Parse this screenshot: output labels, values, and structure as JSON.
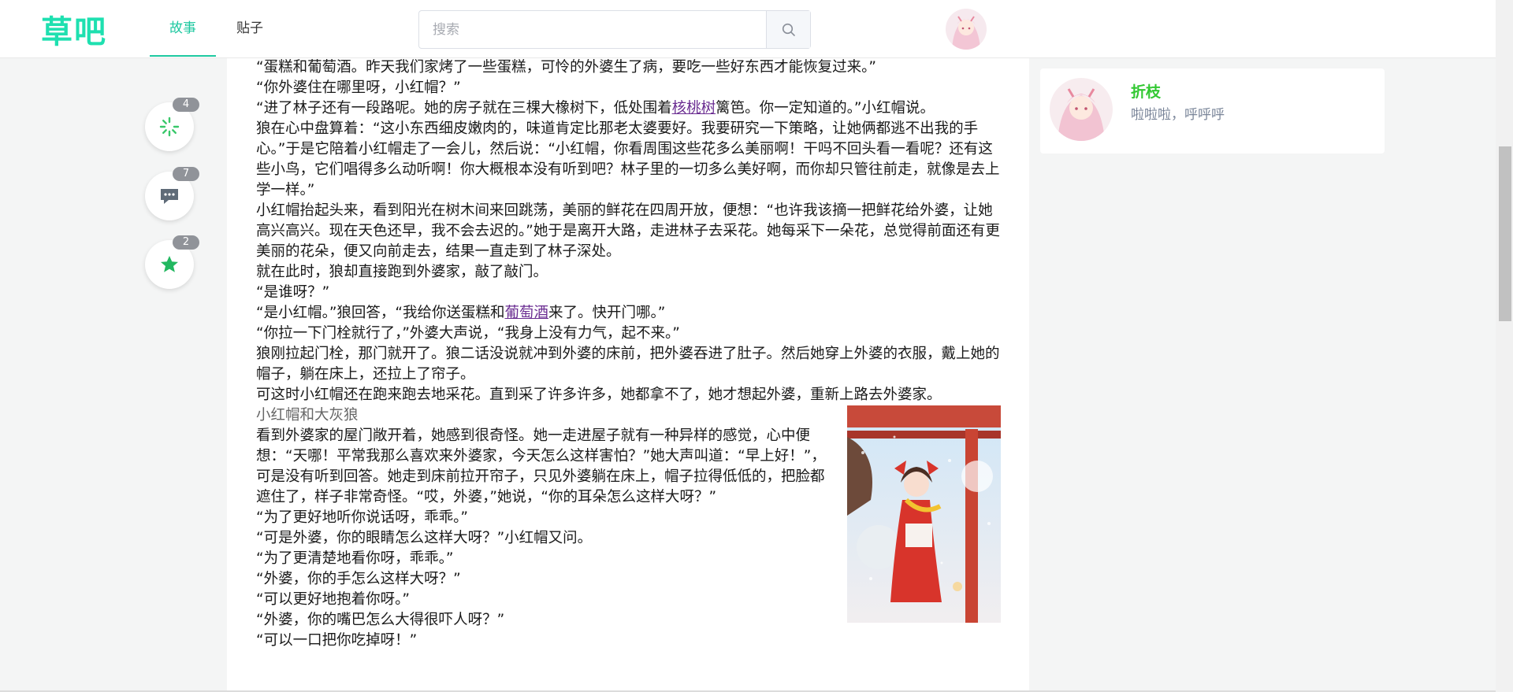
{
  "header": {
    "logo": "草吧",
    "tabs": [
      {
        "label": "故事",
        "active": true
      },
      {
        "label": "贴子",
        "active": false
      }
    ],
    "search": {
      "placeholder": "搜索",
      "value": ""
    }
  },
  "actions": [
    {
      "icon": "loading-icon",
      "count": "4"
    },
    {
      "icon": "comment-icon",
      "count": "7"
    },
    {
      "icon": "star-icon",
      "count": "2"
    }
  ],
  "article": {
    "p1": "“蛋糕和葡萄酒。昨天我们家烤了一些蛋糕，可怜的外婆生了病，要吃一些好东西才能恢复过来。”",
    "p2": "“你外婆住在哪里呀，小红帽？”",
    "p3_before": "“进了林子还有一段路呢。她的房子就在三棵大橡树下，低处围着",
    "p3_link": "核桃树",
    "p3_after": "篱笆。你一定知道的。”小红帽说。",
    "p4": "狼在心中盘算着：“这小东西细皮嫩肉的，味道肯定比那老太婆要好。我要研究一下策略，让她俩都逃不出我的手心。”于是它陪着小红帽走了一会儿，然后说：“小红帽，你看周围这些花多么美丽啊！干吗不回头看一看呢？还有这些小鸟，它们唱得多么动听啊！你大概根本没有听到吧？林子里的一切多么美好啊，而你却只管往前走，就像是去上学一样。”",
    "p5": "小红帽抬起头来，看到阳光在树木间来回跳荡，美丽的鲜花在四周开放，便想：“也许我该摘一把鲜花给外婆，让她高兴高兴。现在天色还早，我不会去迟的。”她于是离开大路，走进林子去采花。她每采下一朵花，总觉得前面还有更美丽的花朵，便又向前走去，结果一直走到了林子深处。",
    "p6": "就在此时，狼却直接跑到外婆家，敲了敲门。",
    "p7": "“是谁呀？”",
    "p8_before": "“是小红帽。”狼回答，“我给你送蛋糕和",
    "p8_link": "葡萄酒",
    "p8_after": "来了。快开门哪。”",
    "p9": "“你拉一下门栓就行了，”外婆大声说，“我身上没有力气，起不来。”",
    "p10": "狼刚拉起门栓，那门就开了。狼二话没说就冲到外婆的床前，把外婆吞进了肚子。然后她穿上外婆的衣服，戴上她的帽子，躺在床上，还拉上了帘子。",
    "p11": "可这时小红帽还在跑来跑去地采花。直到采了许多许多，她都拿不了，她才想起外婆，重新上路去外婆家。",
    "subheading": "小红帽和大灰狼",
    "p12": "看到外婆家的屋门敞开着，她感到很奇怪。她一走进屋子就有一种异样的感觉，心中便想：“天哪！平常我那么喜欢来外婆家，今天怎么这样害怕？”她大声叫道：“早上好！”，可是没有听到回答。她走到床前拉开帘子，只见外婆躺在床上，帽子拉得低低的，把脸都遮住了，样子非常奇怪。“哎，外婆，”她说，“你的耳朵怎么这样大呀？”",
    "p13": "“为了更好地听你说话呀，乖乖。”",
    "p14": "“可是外婆，你的眼睛怎么这样大呀？”小红帽又问。",
    "p15": "“为了更清楚地看你呀，乖乖。”",
    "p16": "“外婆，你的手怎么这样大呀？”",
    "p17": "“可以更好地抱着你呀。”",
    "p18": "“外婆，你的嘴巴怎么大得很吓人呀？”",
    "p19": "“可以一口把你吃掉呀！”"
  },
  "profile": {
    "name": "折枝",
    "bio": "啦啦啦，呼呼呼"
  },
  "colors": {
    "brand": "#1ee0b0",
    "active_tab": "#1ec8a0",
    "profile_name": "#32c832",
    "link": "#6a2c91"
  }
}
